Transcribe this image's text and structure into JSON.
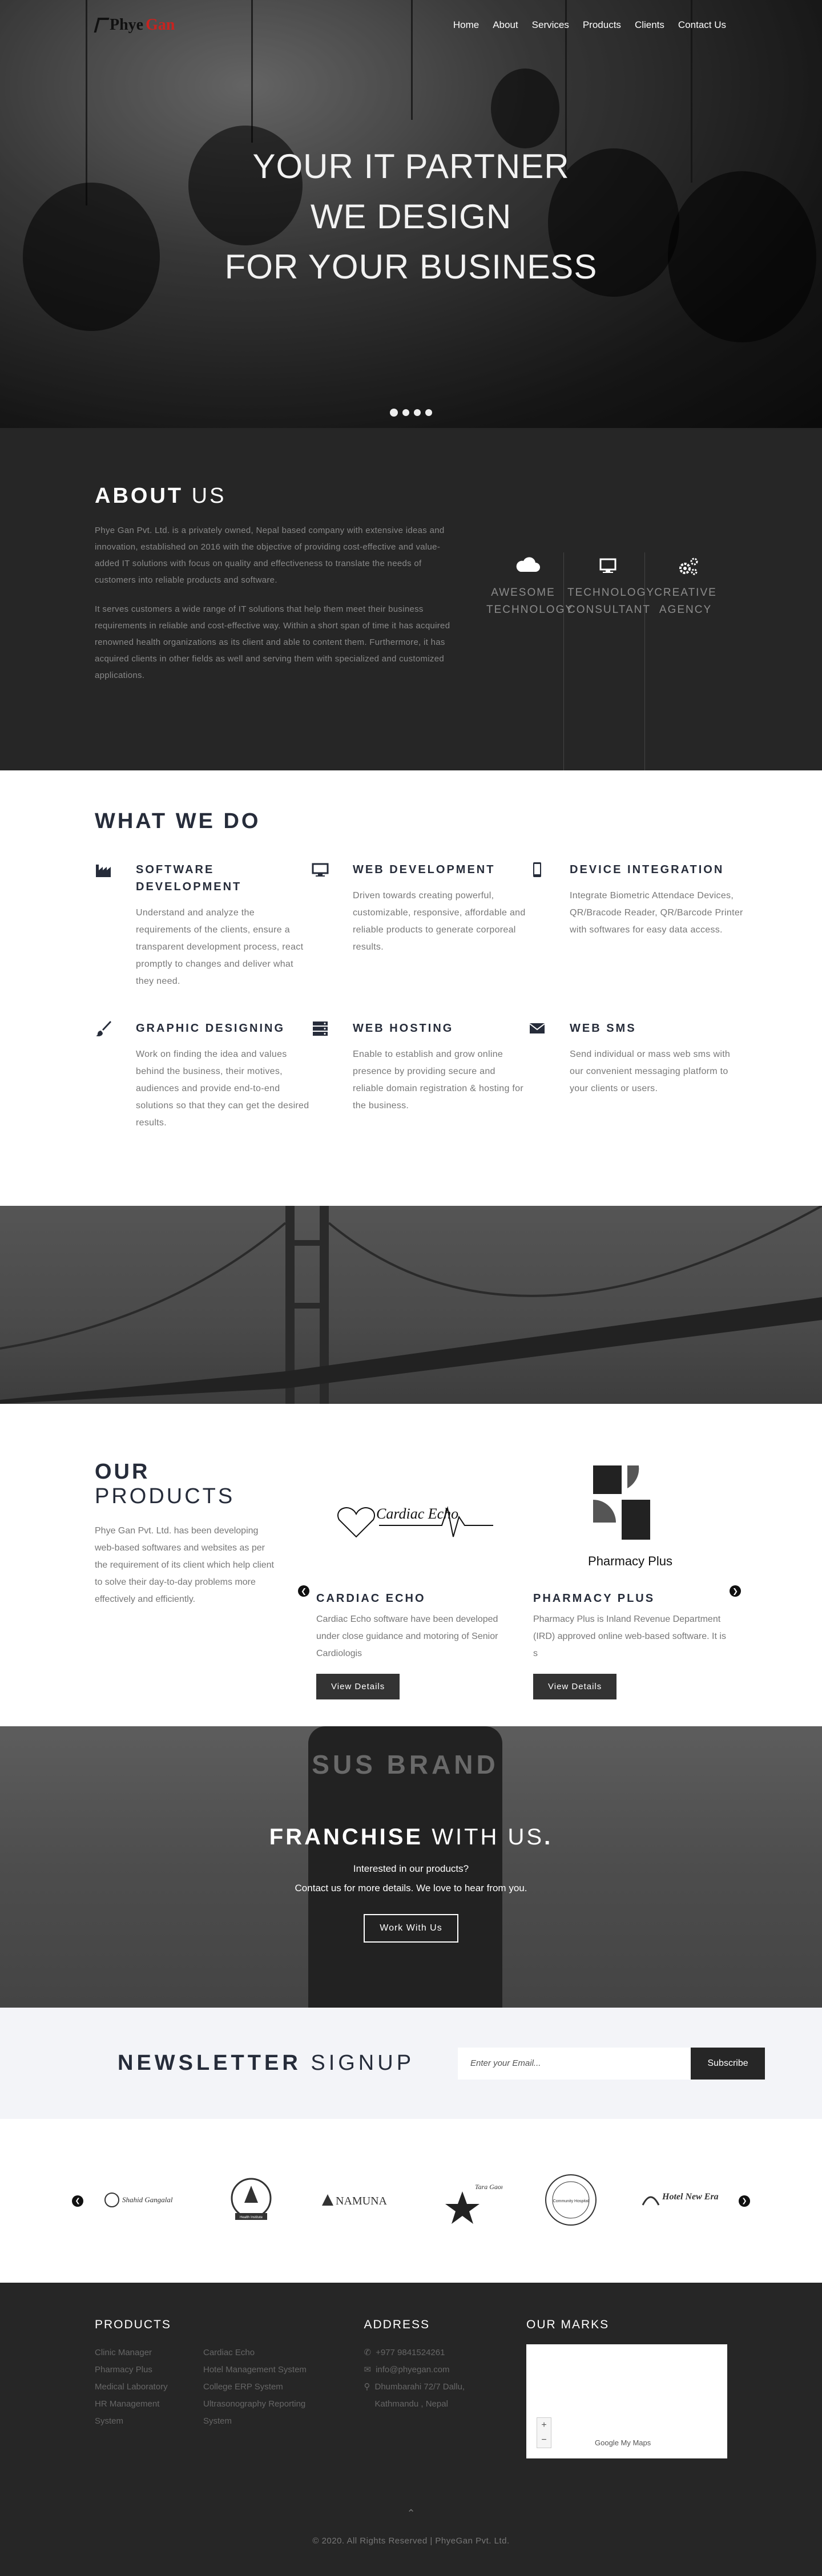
{
  "nav": {
    "logo_part1": "Phye",
    "logo_part2": "Gan",
    "items": [
      {
        "label": "Home"
      },
      {
        "label": "About"
      },
      {
        "label": "Services"
      },
      {
        "label": "Products"
      },
      {
        "label": "Clients"
      },
      {
        "label": "Contact Us"
      }
    ]
  },
  "hero": {
    "line1": "YOUR IT PARTNER",
    "line2": "WE DESIGN",
    "line3": "FOR YOUR BUSINESS",
    "slide_count": 4,
    "active_slide": 1
  },
  "about": {
    "title_bold": "ABOUT",
    "title_thin": "US",
    "para1": "Phye Gan Pvt. Ltd. is a privately owned, Nepal based company with extensive ideas and innovation, established on 2016 with the objective of providing cost-effective and value-added IT solutions with focus on quality and effectiveness to translate the needs of customers into reliable products and software.",
    "para2": "It serves customers a wide range of IT solutions that help them meet their business requirements in reliable and cost-effective way.  Within a short span of time it has acquired renowned health organizations as its client and able to content them. Furthermore, it has acquired clients in other fields as well and serving them with specialized and customized applications.",
    "features": [
      {
        "icon": "cloud-icon",
        "line1": "AWESOME",
        "line2": "TECHNOLOGY"
      },
      {
        "icon": "monitor-icon",
        "line1": "TECHNOLOGY",
        "line2": "CONSULTANT"
      },
      {
        "icon": "gears-icon",
        "line1": "CREATIVE",
        "line2": "AGENCY"
      }
    ]
  },
  "services": {
    "title": "WHAT WE DO",
    "items": [
      {
        "icon": "factory-icon",
        "title": "SOFTWARE DEVELOPMENT",
        "desc": "Understand and analyze the requirements of the clients, ensure a transparent development process, react promptly to changes and deliver what they need."
      },
      {
        "icon": "desktop-icon",
        "title": "WEB DEVELOPMENT",
        "desc": "Driven towards creating powerful, customizable, responsive, affordable and reliable products to generate corporeal results."
      },
      {
        "icon": "mobile-icon",
        "title": "DEVICE INTEGRATION",
        "desc": "Integrate Biometric Attendace Devices, QR/Bracode Reader, QR/Barcode Printer with softwares for easy data access."
      },
      {
        "icon": "paintbrush-icon",
        "title": "GRAPHIC DESIGNING",
        "desc": "Work on finding the idea and values behind the business, their motives, audiences and provide end-to-end solutions so that they can get the desired results."
      },
      {
        "icon": "server-icon",
        "title": "WEB HOSTING",
        "desc": "Enable to establish and grow online presence by providing secure and reliable domain registration & hosting for the business."
      },
      {
        "icon": "envelope-icon",
        "title": "WEB SMS",
        "desc": "Send individual or mass web sms with our convenient messaging platform to your clients or users."
      }
    ]
  },
  "products": {
    "title_bold": "OUR",
    "title_thin": "PRODUCTS",
    "intro": "Phye Gan Pvt. Ltd. has been developing web-based softwares and websites as per the requirement of its client which help client to solve their day-to-day problems more effectively and efficiently.",
    "items": [
      {
        "name": "CARDIAC ECHO",
        "logo_text": "Cardiac Echo",
        "desc": "Cardiac Echo software have been developed under close guidance and motoring of Senior Cardiologis",
        "button": "View Details"
      },
      {
        "name": "PHARMACY PLUS",
        "logo_text": "Pharmacy Plus",
        "desc": "Pharmacy Plus is Inland Revenue Department (IRD) approved online web-based software. It is s",
        "button": "View Details"
      }
    ]
  },
  "franchise": {
    "title_bold": "FRANCHISE",
    "title_thin": "WITH US",
    "title_end": ".",
    "line1": "Interested in our products?",
    "line2": "Contact us for more details. We love to hear from you.",
    "button": "Work With Us",
    "backdrop_text": "SUS BRAND"
  },
  "newsletter": {
    "title_bold": "NEWSLETTER",
    "title_thin": "SIGNUP",
    "placeholder": "Enter your Email...",
    "button": "Subscribe"
  },
  "clients": {
    "logos": [
      "Shahid Gangalal",
      "Health Institute",
      "NAMUNA",
      "Tara Gaon",
      "Community Hospital",
      "Hotel New Era"
    ]
  },
  "footer": {
    "products_title": "PRODUCTS",
    "products_col1": [
      "Clinic Manager",
      "Pharmacy Plus",
      "Medical Laboratory",
      "HR Management",
      "System"
    ],
    "products_col2": [
      "Cardiac Echo",
      "Hotel Management System",
      "College ERP System",
      "Ultrasonography Reporting",
      "System"
    ],
    "address_title": "ADDRESS",
    "phone": "+977 9841524261",
    "email": "info@phyegan.com",
    "address_line1": "Dhumbarahi 72/7 Dallu,",
    "address_line2": "Kathmandu , Nepal",
    "marks_title": "OUR MARKS",
    "map_label": "Google My Maps",
    "copyright": "© 2020. All Rights Reserved | PhyeGan Pvt. Ltd."
  }
}
